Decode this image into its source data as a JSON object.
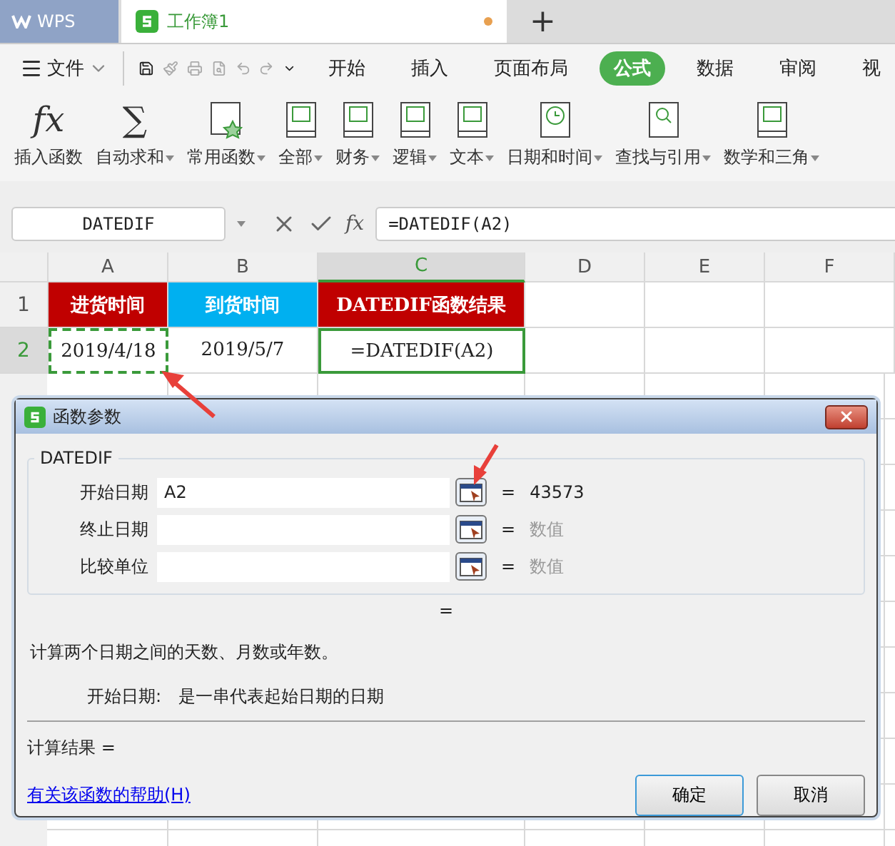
{
  "app_tab": {
    "label": "WPS"
  },
  "doc_tabs": [
    {
      "label": "工作簿1",
      "selected": true,
      "unsaved": true
    }
  ],
  "new_tab": "+",
  "file_menu": "文件",
  "menu_tabs": [
    {
      "label": "开始",
      "selected": false
    },
    {
      "label": "插入",
      "selected": false
    },
    {
      "label": "页面布局",
      "selected": false
    },
    {
      "label": "公式",
      "selected": true
    },
    {
      "label": "数据",
      "selected": false
    },
    {
      "label": "审阅",
      "selected": false
    },
    {
      "label": "视",
      "selected": false
    }
  ],
  "ribbon": [
    {
      "kind": "glyph",
      "glyph": "fx",
      "label": "插入函数",
      "dropdown": false
    },
    {
      "kind": "glyph",
      "glyph": "∑",
      "label": "自动求和",
      "dropdown": true
    },
    {
      "kind": "star",
      "label": "常用函数",
      "dropdown": true
    },
    {
      "kind": "book",
      "label": "全部",
      "dropdown": true
    },
    {
      "kind": "book",
      "label": "财务",
      "dropdown": true
    },
    {
      "kind": "book",
      "label": "逻辑",
      "dropdown": true
    },
    {
      "kind": "book",
      "label": "文本",
      "dropdown": true
    },
    {
      "kind": "clock",
      "label": "日期和时间",
      "dropdown": true
    },
    {
      "kind": "lens",
      "label": "查找与引用",
      "dropdown": true
    },
    {
      "kind": "book",
      "label": "数学和三角",
      "dropdown": true
    }
  ],
  "name_box": "DATEDIF",
  "fx_label": "fx",
  "formula": "=DATEDIF(A2)",
  "columns": [
    {
      "label": "A",
      "selected": false
    },
    {
      "label": "B",
      "selected": false
    },
    {
      "label": "C",
      "selected": true
    },
    {
      "label": "D",
      "selected": false
    },
    {
      "label": "E",
      "selected": false
    },
    {
      "label": "F",
      "selected": false
    }
  ],
  "rows": [
    {
      "header": "1",
      "selected": false,
      "cells": [
        {
          "text": "进货时间",
          "color": "#c00000"
        },
        {
          "text": "到货时间",
          "color": "#00b0f0"
        },
        {
          "text": "DATEDIF函数结果",
          "color": "#c00000"
        }
      ]
    },
    {
      "header": "2",
      "selected": true,
      "cells": [
        {
          "text": "2019/4/18",
          "marquee": true
        },
        {
          "text": "2019/5/7"
        },
        {
          "text": "=DATEDIF(A2)",
          "selected": true
        }
      ]
    }
  ],
  "dialog": {
    "title": "函数参数",
    "function": "DATEDIF",
    "args": [
      {
        "label": "开始日期",
        "value": "A2",
        "equals": "=",
        "result": "43573",
        "placeholder_result": false
      },
      {
        "label": "终止日期",
        "equals": "=",
        "result": "数值",
        "placeholder_result": true
      },
      {
        "label": "比较单位",
        "equals": "=",
        "result": "数值",
        "placeholder_result": true
      }
    ],
    "formula_result": "=",
    "description": "计算两个日期之间的天数、月数或年数。",
    "arg_name": "开始日期:",
    "arg_help": "是一串代表起始日期的日期",
    "calc_result": "计算结果 =",
    "help_link": "有关该函数的帮助(H)",
    "buttons": [
      {
        "label": "确定",
        "default": true
      },
      {
        "label": "取消",
        "default": false
      }
    ]
  }
}
